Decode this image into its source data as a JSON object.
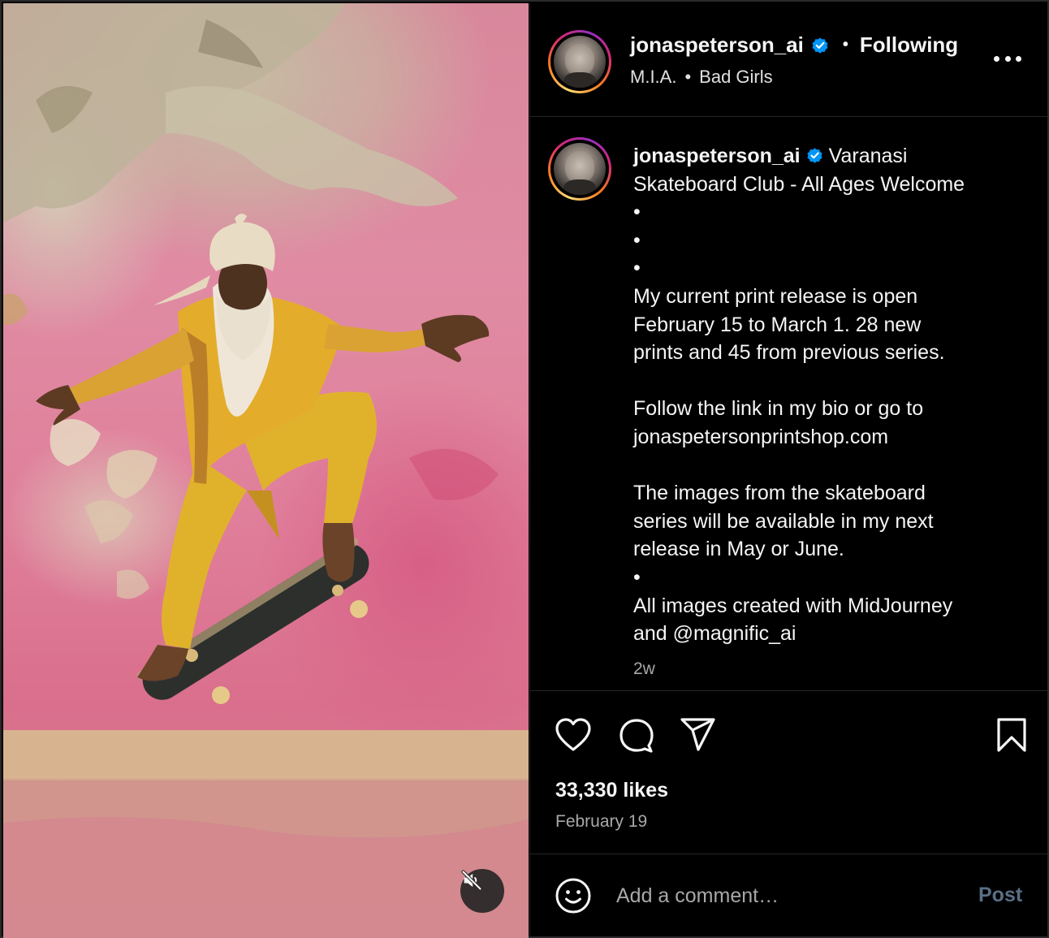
{
  "header": {
    "username": "jonaspeterson_ai",
    "dot": "•",
    "follow_label": "Following",
    "audio_artist": "M.I.A.",
    "audio_sep": "•",
    "audio_track": "Bad Girls",
    "more_icon": "more-horizontal-icon"
  },
  "caption": {
    "username": "jonaspeterson_ai",
    "lines": [
      "Varanasi",
      "Skateboard Club - All Ages Welcome",
      "•",
      "•",
      "•",
      "My current print release is open",
      "February 15 to March 1. 28 new",
      "prints and 45 from previous series.",
      "",
      "Follow the link in my bio or go to",
      "jonaspetersonprintshop.com",
      "",
      "The images from the skateboard",
      "series will be available in my next",
      "release in May or June.",
      "•",
      "All images created with MidJourney",
      "and @magnific_ai"
    ],
    "time": "2w"
  },
  "actions": {
    "icons": [
      "heart-icon",
      "comment-icon",
      "share-icon",
      "bookmark-icon"
    ],
    "likes": "33,330 likes",
    "date": "February 19"
  },
  "comment": {
    "placeholder": "Add a comment…",
    "post_label": "Post",
    "emoji_icon": "emoji-icon"
  },
  "media": {
    "mute_icon": "speaker-muted-icon"
  },
  "colors": {
    "background": "#000000",
    "text": "#f5f5f5",
    "muted_text": "#a8a8a8",
    "verified_blue": "#0095f6",
    "post_button": "#5a6f86",
    "wall_pink": "#e08ba3",
    "robe_yellow": "#e0b22c"
  }
}
